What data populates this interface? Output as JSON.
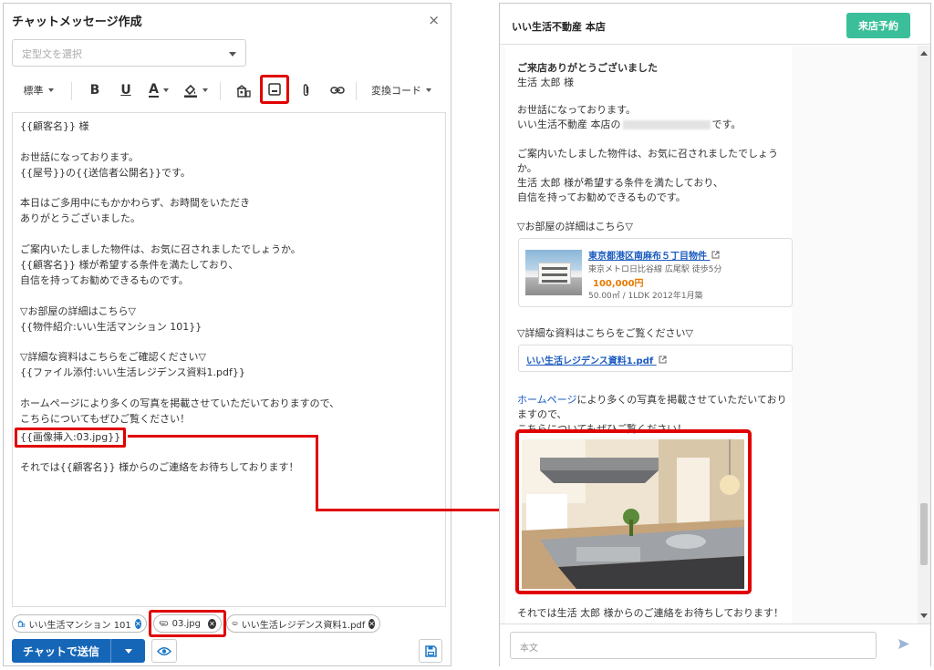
{
  "left": {
    "title": "チャットメッセージ作成",
    "close": "×",
    "template_placeholder": "定型文を選択",
    "toolbar": {
      "font_size": "標準",
      "bold": "B",
      "underline": "U",
      "font_color": "A",
      "convert_code": "変換コード"
    },
    "editor_lines": [
      "{{顧客名}} 様",
      "",
      "お世話になっております。",
      "{{屋号}}の{{送信者公開名}}です。",
      "",
      "本日はご多用中にもかかわらず、お時間をいただき",
      "ありがとうございました。",
      "",
      "ご案内いたしました物件は、お気に召されましたでしょうか。",
      "{{顧客名}} 様が希望する条件を満たしており、",
      "自信を持ってお勧めできるものです。",
      "",
      "▽お部屋の詳細はこちら▽",
      "{{物件紹介:いい生活マンション 101}}",
      "",
      "▽詳細な資料はこちらをご確認ください▽",
      "{{ファイル添付:いい生活レジデンス資料1.pdf}}",
      "",
      "ホームページにより多くの写真を掲載させていただいておりますので、",
      "こちらについてもぜひご覧ください！",
      "{{画像挿入:03.jpg}}",
      "",
      "それでは{{顧客名}} 様からのご連絡をお待ちしております！"
    ],
    "attachments": [
      {
        "label": "いい生活マンション 101"
      },
      {
        "label": "03.jpg"
      },
      {
        "label": "いい生活レジデンス資料1.pdf"
      }
    ],
    "send_label": "チャットで送信"
  },
  "right": {
    "title": "いい生活不動産 本店",
    "visit_button": "来店予約",
    "messages": {
      "thanks": "ご来店ありがとうございました",
      "customer": "生活 太郎 様",
      "greeting": "お世話になっております。",
      "sender_prefix": "いい生活不動産 本店の",
      "sender_suffix": "です。",
      "p2_1": "ご案内いたしました物件は、お気に召されましたでしょう",
      "p2_2": "か。",
      "p2_3": "生活 太郎 様が希望する条件を満たしており、",
      "p2_4": "自信を持ってお勧めできるものです。",
      "room_details": "▽お部屋の詳細はこちら▽",
      "file_details": "▽詳細な資料はこちらをご覧ください▽",
      "hp_link": "ホームページ",
      "hp_rest": "により多くの写真を掲載させていただいており",
      "hp_line2": "ますので、",
      "hp_line3": "こちらについてもぜひご覧ください！",
      "closing": "それでは生活 太郎 様からのご連絡をお待ちしております！"
    },
    "property": {
      "name": "東京都港区南麻布５丁目物件",
      "station": "東京メトロ日比谷線 広尾駅 徒歩5分",
      "price": "100,000円",
      "spec": "50.00㎡ / 1LDK  2012年1月築"
    },
    "file_name": "いい生活レジデンス資料1.pdf",
    "input_placeholder": "本文"
  }
}
